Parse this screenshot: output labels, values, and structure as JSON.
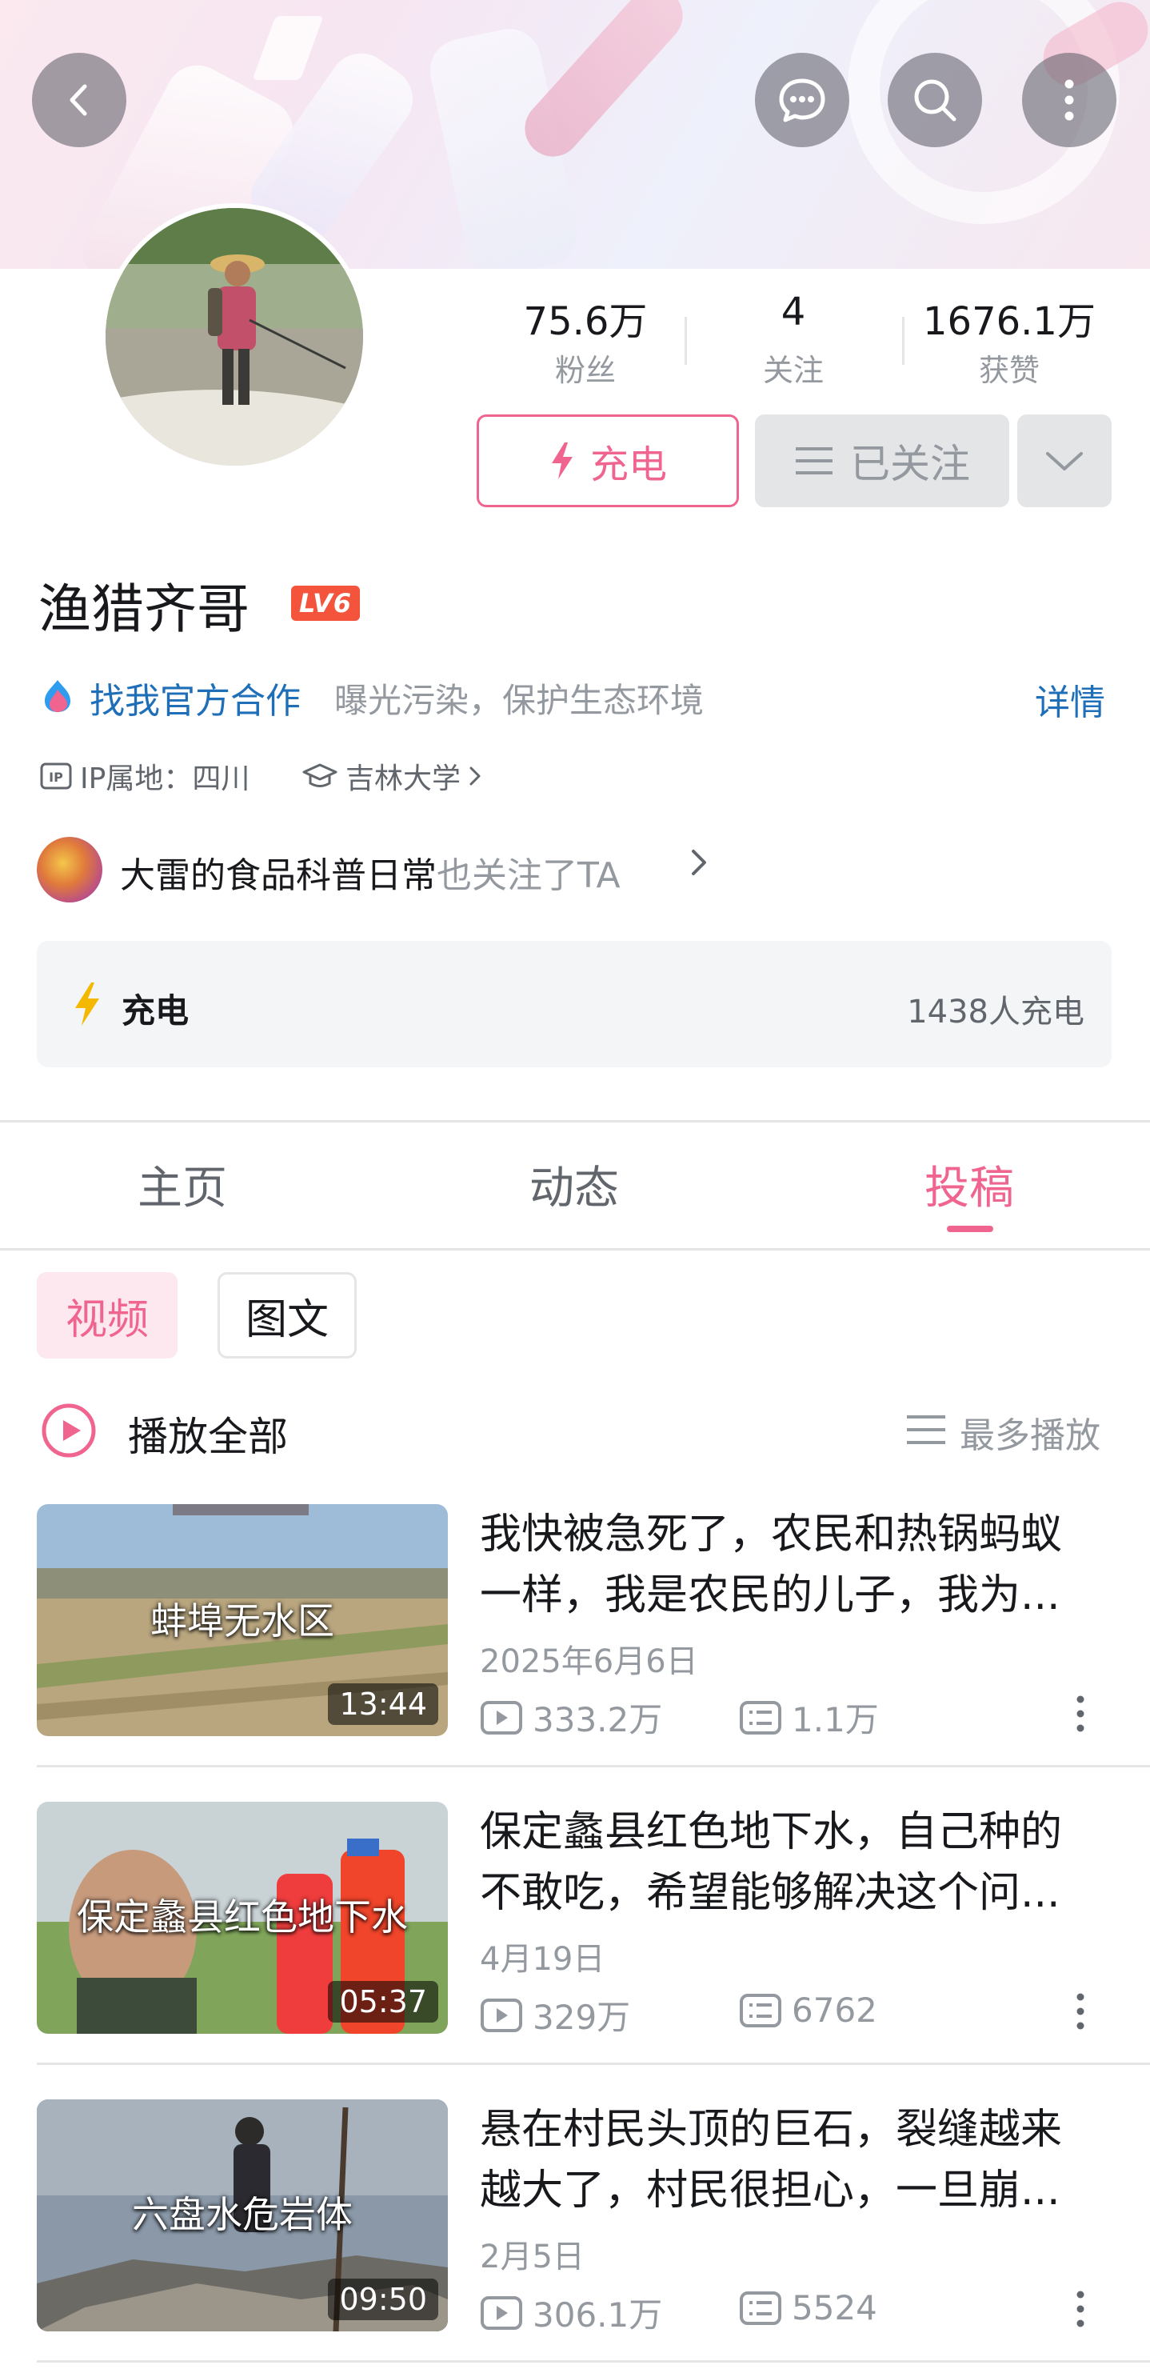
{
  "header": {
    "back_icon": "chevron-left-icon",
    "message_icon": "chat-bubble-icon",
    "search_icon": "search-icon",
    "more_icon": "vertical-dots-icon"
  },
  "profile": {
    "name": "渔猎齐哥",
    "level_badge": "LV6",
    "stats": [
      {
        "value": "75.6万",
        "label": "粉丝"
      },
      {
        "value": "4",
        "label": "关注"
      },
      {
        "value": "1676.1万",
        "label": "获赞"
      }
    ],
    "charge_button": "充电",
    "followed_button": "已关注",
    "cooperation_link": "找我官方合作",
    "bio": "曝光污染，保护生态环境",
    "details_link": "详情",
    "ip_location": "IP属地：四川",
    "school": "吉林大学",
    "mutual_name": "大雷的食品科普日常",
    "mutual_suffix": "也关注了TA",
    "charge_panel_label": "充电",
    "charge_panel_count": "1438人充电"
  },
  "tabs": [
    {
      "label": "主页",
      "active": false
    },
    {
      "label": "动态",
      "active": false
    },
    {
      "label": "投稿",
      "active": true
    }
  ],
  "filters": {
    "video": "视频",
    "article": "图文"
  },
  "list_header": {
    "play_all": "播放全部",
    "sort": "最多播放"
  },
  "videos": [
    {
      "thumb_text": "蚌埠无水区",
      "duration": "13:44",
      "title_line1": "我快被急死了，农民和热锅蚂蚁",
      "title_line2": "一样，我是农民的儿子，我为...",
      "date": "2025年6月6日",
      "plays": "333.2万",
      "danmaku": "1.1万"
    },
    {
      "thumb_text": "保定蠡县红色地下水",
      "duration": "05:37",
      "title_line1": "保定蠡县红色地下水，自己种的",
      "title_line2": "不敢吃，希望能够解决这个问...",
      "date": "4月19日",
      "plays": "329万",
      "danmaku": "6762"
    },
    {
      "thumb_text": "六盘水危岩体",
      "duration": "09:50",
      "title_line1": "悬在村民头顶的巨石，裂缝越来",
      "title_line2": "越大了，村民很担心，一旦崩...",
      "date": "2月5日",
      "plays": "306.1万",
      "danmaku": "5524"
    }
  ],
  "colors": {
    "accent": "#f0658f",
    "link": "#1f6fb8",
    "level": "#f3543b",
    "charge": "#f5b800"
  }
}
